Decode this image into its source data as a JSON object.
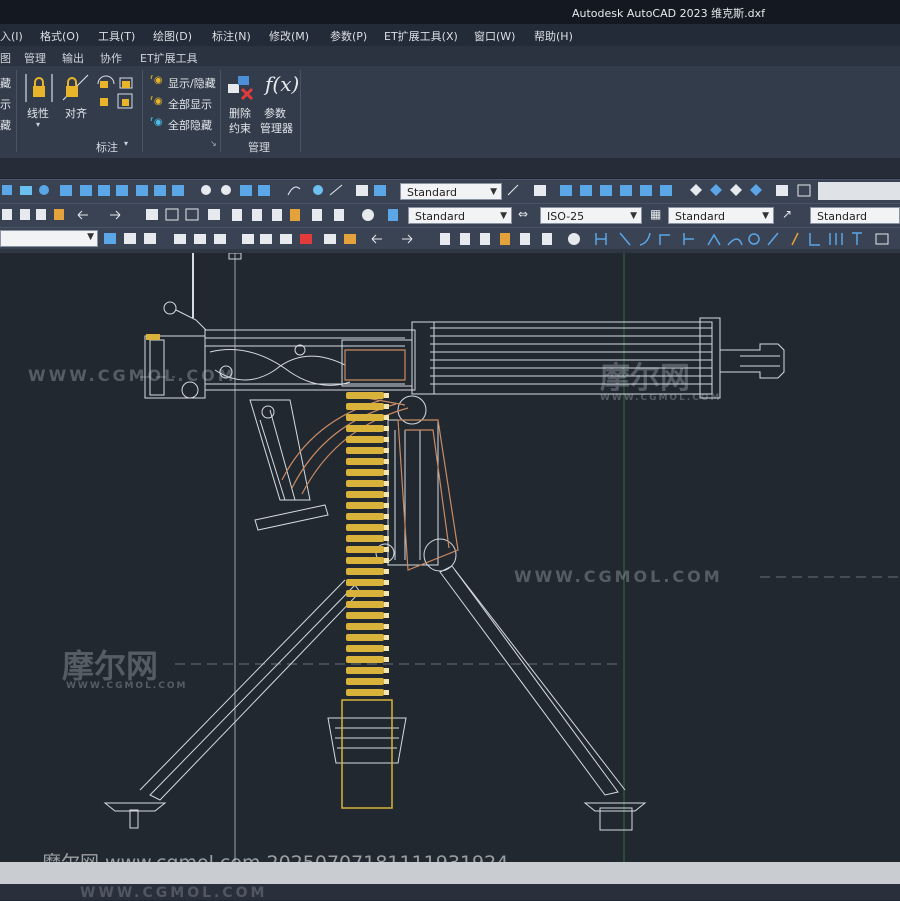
{
  "window": {
    "title": "Autodesk AutoCAD 2023    维克斯.dxf"
  },
  "menu": {
    "items": [
      "入(I)",
      "格式(O)",
      "工具(T)",
      "绘图(D)",
      "标注(N)",
      "修改(M)",
      "参数(P)",
      "ET扩展工具(X)",
      "窗口(W)",
      "帮助(H)"
    ]
  },
  "ribbon_tabs": {
    "items": [
      "图",
      "管理",
      "输出",
      "协作",
      "ET扩展工具"
    ]
  },
  "ribbon": {
    "left_labels": [
      "藏",
      "示",
      "藏"
    ],
    "linetype": "线性",
    "align": "对齐",
    "show_hide": "显示/隐藏",
    "show_all": "全部显示",
    "hide_all": "全部隐藏",
    "delete_constraint_1": "删除",
    "delete_constraint_2": "约束",
    "param_manager_1": "参数",
    "param_manager_2": "管理器",
    "fx": "f(x)",
    "panel_dimension": "标注",
    "panel_manage": "管理"
  },
  "toolbars": {
    "text_style_1": "Standard",
    "text_style_2": "Standard",
    "dim_style": "ISO-25",
    "table_style": "Standard",
    "multileader_style": "Standard"
  },
  "watermarks": {
    "brand": "摩尔网",
    "site": "WWW.CGMOL.COM",
    "site_small": "WWW.CGMOL.COM",
    "stamp": "摩尔网 www.cgmol.com 20250707181111931924"
  },
  "colors": {
    "accent_brass": "#d8b23a",
    "copper": "#c98a62",
    "wire": "#d6dbe3"
  }
}
